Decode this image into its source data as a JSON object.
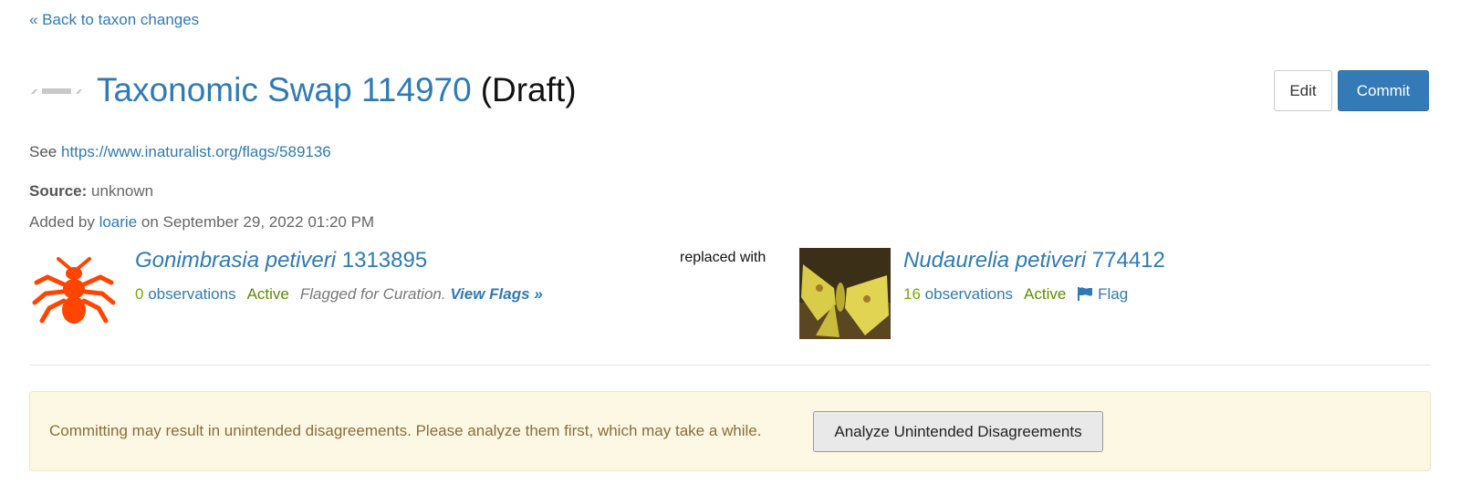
{
  "nav": {
    "back_label": "« Back to taxon changes"
  },
  "header": {
    "title": "Taxonomic Swap 114970",
    "status": "(Draft)",
    "edit_label": "Edit",
    "commit_label": "Commit"
  },
  "details": {
    "see_prefix": "See",
    "see_url": "https://www.inaturalist.org/flags/589136",
    "source_label": "Source:",
    "source_value": "unknown",
    "added_prefix": "Added by",
    "added_user": "loarie",
    "added_suffix": "on September 29, 2022 01:20 PM"
  },
  "taxon_from": {
    "name": "Gonimbrasia petiveri",
    "id": "1313895",
    "obs_count": "0",
    "obs_label": "observations",
    "status": "Active",
    "flag_note": "Flagged for Curation.",
    "view_flags": "View Flags »",
    "icon": "insect-icon",
    "icon_color": "#ff4500"
  },
  "replaced_with": "replaced with",
  "taxon_to": {
    "name": "Nudaurelia petiveri",
    "id": "774412",
    "obs_count": "16",
    "obs_label": "observations",
    "status": "Active",
    "flag_label": "Flag"
  },
  "alert": {
    "message": "Committing may result in unintended disagreements. Please analyze them first, which may take a while.",
    "button_label": "Analyze Unintended Disagreements"
  },
  "colors": {
    "link": "#2f7ab5",
    "primary_button": "#337ab7",
    "active_green": "#5e8c00",
    "count_green": "#74ac00",
    "alert_bg": "#fcf8e3",
    "alert_text": "#8a6d3b"
  }
}
